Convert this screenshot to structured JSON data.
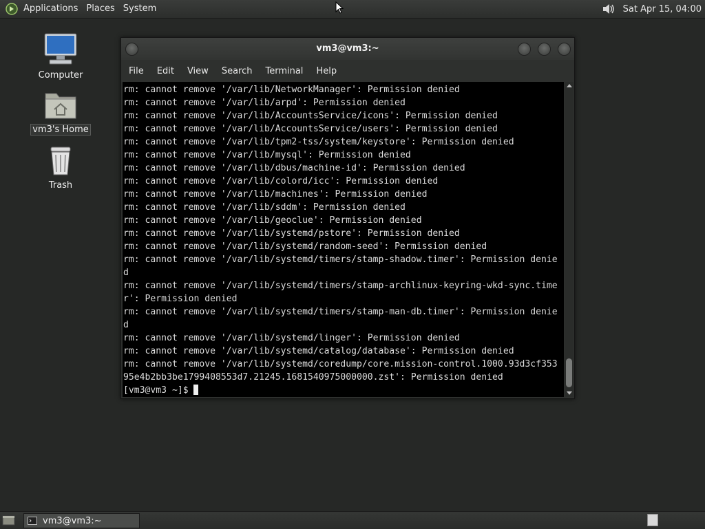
{
  "top_panel": {
    "menus": [
      "Applications",
      "Places",
      "System"
    ],
    "clock": "Sat Apr 15, 04:00"
  },
  "desktop": {
    "icons": [
      {
        "label": "Computer",
        "icon": "computer-icon"
      },
      {
        "label": "vm3's Home",
        "icon": "home-folder-icon"
      },
      {
        "label": "Trash",
        "icon": "trash-icon"
      }
    ]
  },
  "terminal_window": {
    "title": "vm3@vm3:~",
    "menu": [
      "File",
      "Edit",
      "View",
      "Search",
      "Terminal",
      "Help"
    ],
    "lines": [
      "rm: cannot remove '/var/lib/NetworkManager': Permission denied",
      "rm: cannot remove '/var/lib/arpd': Permission denied",
      "rm: cannot remove '/var/lib/AccountsService/icons': Permission denied",
      "rm: cannot remove '/var/lib/AccountsService/users': Permission denied",
      "rm: cannot remove '/var/lib/tpm2-tss/system/keystore': Permission denied",
      "rm: cannot remove '/var/lib/mysql': Permission denied",
      "rm: cannot remove '/var/lib/dbus/machine-id': Permission denied",
      "rm: cannot remove '/var/lib/colord/icc': Permission denied",
      "rm: cannot remove '/var/lib/machines': Permission denied",
      "rm: cannot remove '/var/lib/sddm': Permission denied",
      "rm: cannot remove '/var/lib/geoclue': Permission denied",
      "rm: cannot remove '/var/lib/systemd/pstore': Permission denied",
      "rm: cannot remove '/var/lib/systemd/random-seed': Permission denied",
      "rm: cannot remove '/var/lib/systemd/timers/stamp-shadow.timer': Permission denie",
      "d",
      "rm: cannot remove '/var/lib/systemd/timers/stamp-archlinux-keyring-wkd-sync.time",
      "r': Permission denied",
      "rm: cannot remove '/var/lib/systemd/timers/stamp-man-db.timer': Permission denie",
      "d",
      "rm: cannot remove '/var/lib/systemd/linger': Permission denied",
      "rm: cannot remove '/var/lib/systemd/catalog/database': Permission denied",
      "rm: cannot remove '/var/lib/systemd/coredump/core.mission-control.1000.93d3cf353",
      "95e4b2bb3be1799408553d7.21245.1681540975000000.zst': Permission denied"
    ],
    "prompt": "[vm3@vm3 ~]$ "
  },
  "bottom_panel": {
    "task_label": "vm3@vm3:~"
  }
}
